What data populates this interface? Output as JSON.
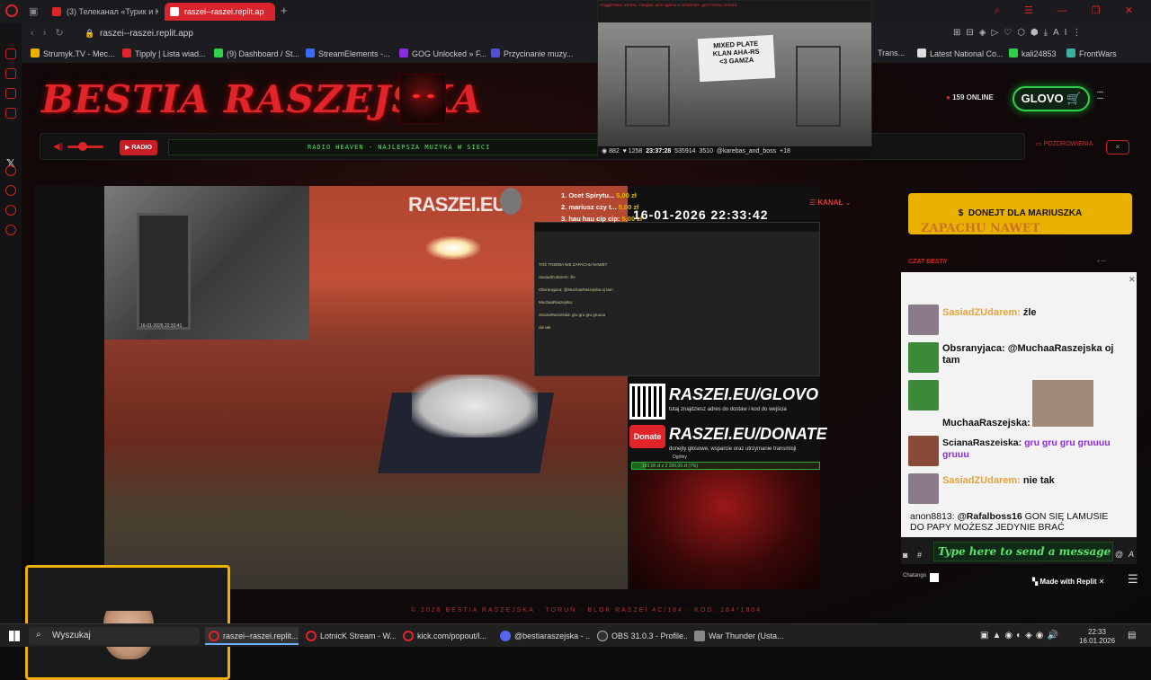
{
  "browser": {
    "tabs": [
      {
        "label": "(3) Телеканал «Турик и К",
        "favicon_color": "#e0242a"
      },
      {
        "label": "raszei--raszei.replit.ap",
        "favicon_color": "#ffffff"
      }
    ],
    "url": "raszei--raszei.replit.app",
    "bookmarks": [
      {
        "label": "Strumyk.TV - Mec...",
        "color": "#f0b000"
      },
      {
        "label": "Tipply | Lista wiad...",
        "color": "#e0242a"
      },
      {
        "label": "(9) Dashboard / St...",
        "color": "#2ed14a"
      },
      {
        "label": "StreamElements -...",
        "color": "#3a6aff"
      },
      {
        "label": "GOG Unlocked » F...",
        "color": "#8a2be2"
      },
      {
        "label": "Przycinanie muzy...",
        "color": "#5050d0"
      },
      {
        "label": "Trans...",
        "color": "#888888"
      },
      {
        "label": "Latest National Co...",
        "color": "#dddddd"
      },
      {
        "label": "kali24853",
        "color": "#2ed14a"
      },
      {
        "label": "FrontWars",
        "color": "#3ab0a0"
      }
    ]
  },
  "site": {
    "title": "BESTIA RASZEJSKA",
    "online": "159 ONLINE",
    "glovo": "GLOVO",
    "radio_label": "RADIO",
    "radio_ticker": "RADIO HEAVEN - NAJLEPSZA MUZYKA W SIECI",
    "greet": "POZDROWIENIA",
    "kanal": "KANAŁ",
    "donate_button": "DONEJT DLA MARIUSZKA",
    "chat_title": "CZAT BESTII",
    "footer": "© 2026 BESTIA RASZEJSKA · TORUŃ · BLOK RASZEI 4C/184 · KOD: 184*1804"
  },
  "stream": {
    "watermark": "RASZEI.EU",
    "timestamp": "16-01-2026 22:33:42",
    "bw_timestamp": "16-01-2026 22:33:41",
    "donors": [
      {
        "name": "1. Ocet Spirytu...",
        "amount": "5,00 zł"
      },
      {
        "name": "2. mariusz czy t...",
        "amount": "5,00 zł"
      },
      {
        "name": "3. hau hau cip cip:",
        "amount": "5,00 zł"
      }
    ],
    "promo_glovo": "RASZEI.EU/GLOVO",
    "promo_glovo_sub": "tutaj znajdziesz adres do dostaw i kod do wejścia",
    "donate_badge": "Donate",
    "promo_donate": "RASZEI.EU/DONATE",
    "promo_donate_sub": "donejty głosowe, wsparcie oraz utrzymanie transmisji",
    "goal_label": "Ogólny",
    "goal_text": "183,00 zł z 2 200,00 zł (7%)",
    "goal_fraction": 0.07,
    "mirror_chat": [
      "TOŚ TRZEBA NIE ZAPACHU NAWET",
      "SasiadZUdarem: źle",
      "Obsranyjaca: @MuchaaRaszejska oj tam",
      "MuchaaRaszejska:",
      "ScianaRaszeiska: gru gru gru gruuuu",
      "nie tak"
    ]
  },
  "overlay": {
    "banner": "MIXED PLATE\nKLAN AHA-RS\n<3 GAMZA",
    "stats": [
      "882",
      "1258",
      "23:37:28",
      "535914",
      "3510",
      "@karebas_and_boss",
      "+18"
    ],
    "top_text": "ПОДДЕРЖКА ЭФИРА · СКИДКА -80% УДАРЫ И ОБЪЯТИЯ · ДОСТУПНА ОПЛАТА"
  },
  "chat": {
    "top_fragment": "ZAPACHU NAWET",
    "messages": [
      {
        "user": "SasiadZUdarem:",
        "text": "źle",
        "user_style": "orange",
        "text_style": "dark",
        "avatar_color": "#8a7a8a"
      },
      {
        "user": "Obsranyjaca:",
        "text": "@MuchaaRaszejska oj tam",
        "user_style": "dark",
        "text_style": "dark",
        "avatar_color": "#3a8a3a"
      },
      {
        "user": "MuchaaRaszejska:",
        "text": "",
        "user_style": "dark",
        "text_style": "dark",
        "avatar_color": "#3a8a3a"
      },
      {
        "user": "ScianaRaszeiska:",
        "text": "gru gru gru gruuuu gruuu",
        "user_style": "dark",
        "text_style": "purple",
        "avatar_color": "#8a4a3a"
      },
      {
        "user": "SasiadZUdarem:",
        "text": "nie tak",
        "user_style": "orange",
        "text_style": "dark",
        "avatar_color": "#8a7a8a"
      }
    ],
    "anon_user": "anon8813:",
    "anon_mention": "@Rafalboss16",
    "anon_text": "GON SIĘ LAMUSIE DO PAPY MOŻESZ JEDYNIE BRAĆ",
    "input_placeholder": "Type here to send a message",
    "chatango": "Chatango",
    "replit": "Made with Replit"
  },
  "taskbar": {
    "search": "Wyszukaj",
    "items": [
      {
        "label": "raszei--raszei.replit...",
        "color": "#e0242a",
        "active": true
      },
      {
        "label": "LotnicK Stream - W...",
        "color": "#e0242a",
        "active": false
      },
      {
        "label": "kick.com/popout/l...",
        "color": "#e0242a",
        "active": false
      },
      {
        "label": "@bestiaraszejska - ...",
        "color": "#5865f2",
        "active": false
      },
      {
        "label": "OBS 31.0.3 - Profile...",
        "color": "#303030",
        "active": false
      },
      {
        "label": "War Thunder (Usta...",
        "color": "#888888",
        "active": false
      }
    ],
    "time": "22:33",
    "date": "16.01.2026"
  }
}
